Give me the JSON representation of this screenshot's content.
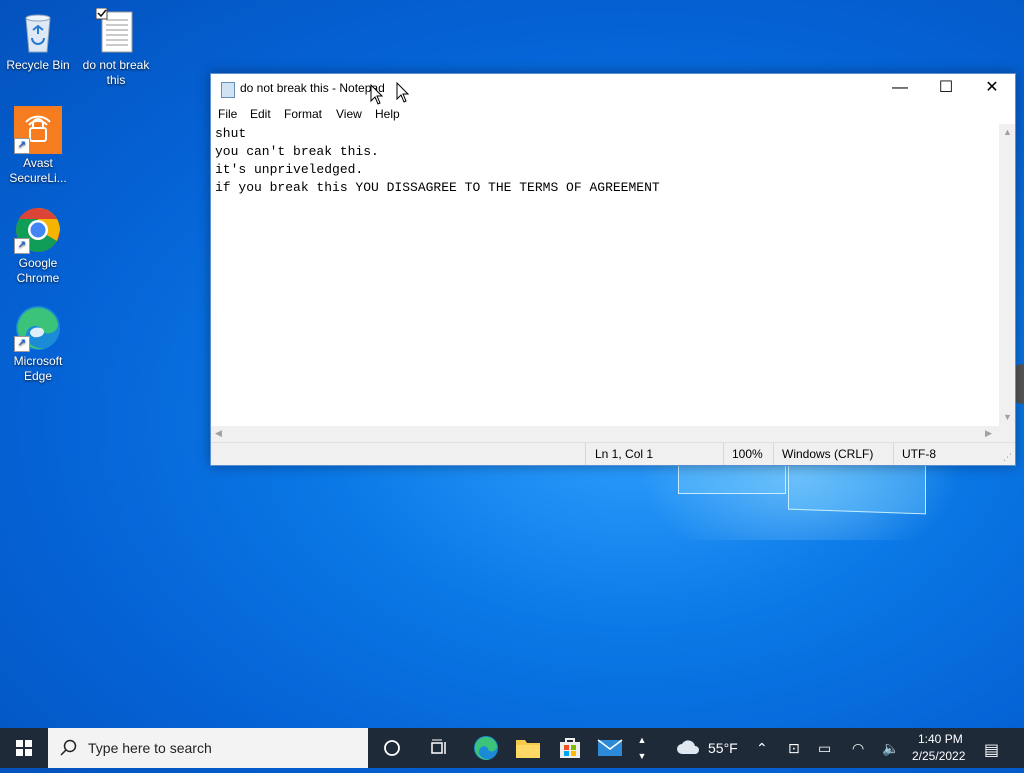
{
  "desktop": {
    "icons": [
      {
        "label": "Recycle Bin"
      },
      {
        "label": "do not break this"
      },
      {
        "label": "Avast SecureLi..."
      },
      {
        "label": "Google Chrome"
      },
      {
        "label": "Microsoft Edge"
      }
    ]
  },
  "notepad": {
    "title": "do not break this - Notepad",
    "menu": [
      "File",
      "Edit",
      "Format",
      "View",
      "Help"
    ],
    "lines": [
      "shut",
      "you can't break this.",
      "it's unpriveledged.",
      "if you break this YOU DISSAGREE TO THE TERMS OF AGREEMENT"
    ],
    "status": {
      "position": "Ln 1, Col 1",
      "zoom": "100%",
      "line_ending": "Windows (CRLF)",
      "encoding": "UTF-8"
    },
    "controls": {
      "minimize": "—",
      "maximize": "☐",
      "close": "✕"
    }
  },
  "taskbar": {
    "search_placeholder": "Type here to search",
    "weather": "55°F",
    "time": "1:40 PM",
    "date": "2/25/2022"
  },
  "colors": {
    "desktop_blue": "#0a78e6",
    "taskbar": "#1f2a38",
    "avast_orange": "#f57c1f"
  }
}
